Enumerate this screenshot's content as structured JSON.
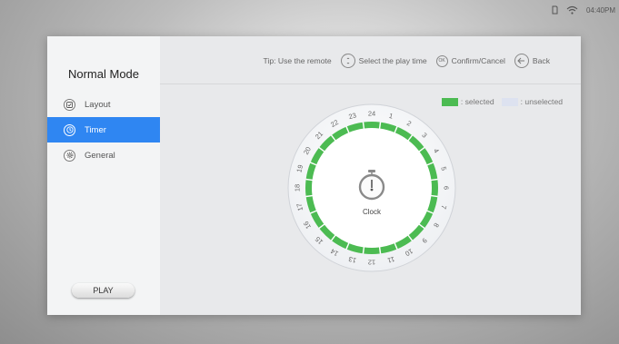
{
  "status_bar": {
    "time": "04:40PM",
    "icons": [
      "sd-card-icon",
      "wifi-icon"
    ]
  },
  "sidebar": {
    "title": "Normal Mode",
    "items": [
      {
        "label": "Layout",
        "icon": "layout-icon",
        "active": false
      },
      {
        "label": "Timer",
        "icon": "clock-icon",
        "active": true
      },
      {
        "label": "General",
        "icon": "gear-icon",
        "active": false
      }
    ],
    "play_label": "PLAY"
  },
  "tip": {
    "prefix": "Tip: Use the remote",
    "select_label": "Select the play time",
    "ok_key": "OK",
    "confirm_label": "Confirm/Cancel",
    "back_label": "Back"
  },
  "legend": {
    "selected_label": ": selected",
    "unselected_label": ": unselected"
  },
  "timer": {
    "center_label": "Clock",
    "hours": [
      "24",
      "1",
      "2",
      "3",
      "4",
      "5",
      "6",
      "7",
      "8",
      "9",
      "10",
      "11",
      "12",
      "13",
      "14",
      "15",
      "16",
      "17",
      "18",
      "19",
      "20",
      "21",
      "22",
      "23"
    ],
    "selected_hours": [
      "24",
      "1",
      "2",
      "3",
      "4",
      "5",
      "6",
      "7",
      "8",
      "9",
      "10",
      "11",
      "12",
      "13",
      "14",
      "15",
      "16",
      "17",
      "18",
      "19",
      "20",
      "21",
      "22",
      "23"
    ]
  },
  "colors": {
    "accent": "#2f86f2",
    "selected": "#4cbb52",
    "unselected": "#dde2f0"
  }
}
